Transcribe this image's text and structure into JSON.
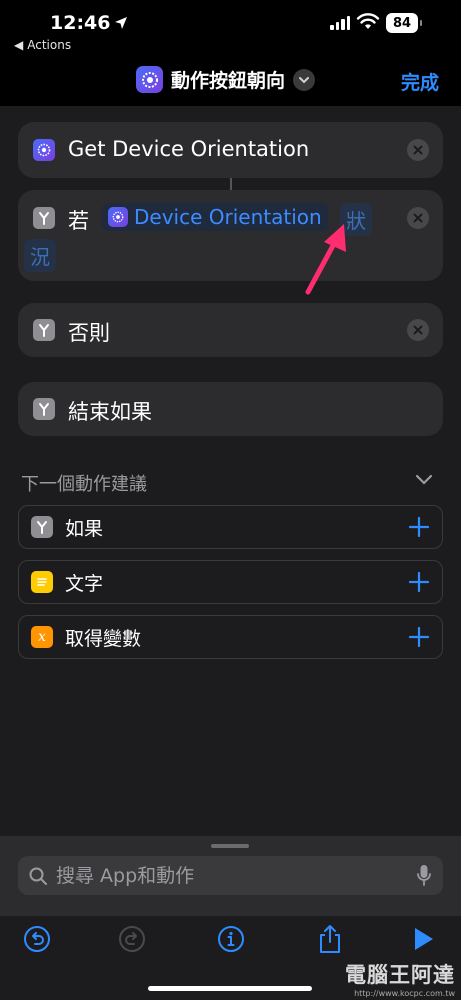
{
  "status_bar": {
    "time": "12:46",
    "back_app": "Actions",
    "battery": "84"
  },
  "nav": {
    "title": "動作按鈕朝向",
    "done": "完成"
  },
  "actions": {
    "get_orientation": "Get Device Orientation",
    "if_keyword": "若",
    "variable_name": "Device Orientation",
    "param_1": "狀",
    "param_2": "況",
    "otherwise": "否則",
    "end_if": "結束如果"
  },
  "suggestions": {
    "title": "下一個動作建議",
    "items": [
      {
        "label": "如果",
        "icon": "branch-icon",
        "color": "#8e8e93"
      },
      {
        "label": "文字",
        "icon": "text-icon",
        "color": "#ffcc00"
      },
      {
        "label": "取得變數",
        "icon": "variable-icon",
        "color": "#ff9500"
      }
    ]
  },
  "search": {
    "placeholder": "搜尋 App和動作"
  },
  "watermark": {
    "main": "電腦王阿達",
    "url": "http://www.kocpc.com.tw"
  },
  "colors": {
    "accent": "#2f8cff",
    "annotation_arrow": "#ff2d6f"
  }
}
